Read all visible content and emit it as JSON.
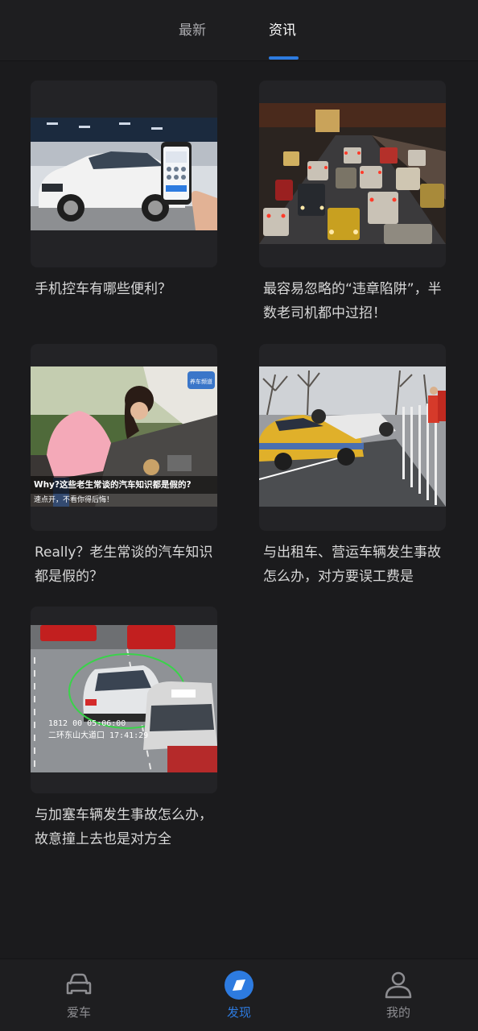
{
  "top_tabs": {
    "latest": "最新",
    "news": "资讯",
    "active": "资讯"
  },
  "articles": [
    {
      "title": "手机控车有哪些便利？"
    },
    {
      "title": "最容易忽略的“违章陷阱”，半数老司机都中过招！"
    },
    {
      "title": "Really？老生常谈的汽车知识都是假的？",
      "image_caption": "Why?这些老生常谈的汽车知识都是假的?",
      "image_subcaption": "速点开，不看你得后悔！",
      "image_badge": "养车频道"
    },
    {
      "title": "与出租车、营运车辆发生事故怎么办，对方要误工费是"
    },
    {
      "title": "与加塞车辆发生事故怎么办，故意撞上去也是对方全",
      "image_cam_text": "1812      00  05:06:00",
      "image_cam_text2": "二环东山大道口  17:41:29"
    }
  ],
  "bottom_nav": {
    "car": {
      "label": "爱车",
      "icon": "car-icon"
    },
    "discover": {
      "label": "发现",
      "icon": "discover-icon"
    },
    "mine": {
      "label": "我的",
      "icon": "user-icon"
    },
    "active": "发现"
  },
  "colors": {
    "background": "#1b1b1d",
    "accent": "#2d7be0",
    "inactive": "#8d8d91"
  }
}
